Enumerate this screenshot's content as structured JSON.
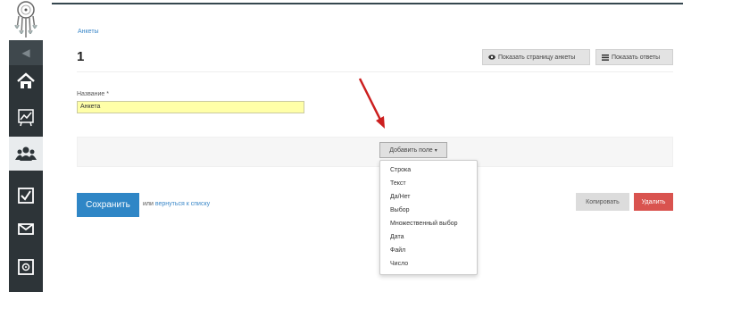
{
  "sidebar": {
    "items": [
      {
        "icon": "home-icon"
      },
      {
        "icon": "chart-icon"
      },
      {
        "icon": "users-icon",
        "active": true
      },
      {
        "icon": "checkbox-icon"
      },
      {
        "icon": "mail-icon"
      },
      {
        "icon": "safe-icon"
      }
    ]
  },
  "breadcrumb": "Анкеты",
  "page_title": "1",
  "header_buttons": {
    "show_page": "Показать страницу анкеты",
    "show_answers": "Показать ответы"
  },
  "form": {
    "name_label": "Название *",
    "name_value": "Анкета"
  },
  "add_field": {
    "label": "Добавить поле",
    "options": [
      "Строка",
      "Текст",
      "Да/Нет",
      "Выбор",
      "Множественный выбор",
      "Дата",
      "Файл",
      "Число"
    ]
  },
  "footer": {
    "save_label": "Сохранить",
    "or_text": "или",
    "back_link": "вернуться к списку",
    "copy_label": "Копировать",
    "delete_label": "Удалить"
  },
  "colors": {
    "sidebar_bg": "#2d3438",
    "accent_blue": "#2f86c6",
    "danger_red": "#d9534f",
    "input_highlight": "#ffffa8",
    "annotation_arrow": "#cc1f1f"
  }
}
